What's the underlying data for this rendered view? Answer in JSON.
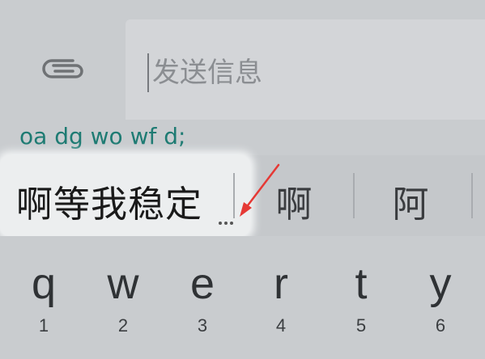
{
  "composer": {
    "attach_icon": "paperclip-icon",
    "placeholder": "发送信息"
  },
  "ime": {
    "pinyin": "oa dg wo wf d;",
    "candidates": [
      {
        "text": "啊等我稳定"
      },
      {
        "text": "啊"
      },
      {
        "text": "阿"
      }
    ],
    "more_icon": "ellipsis-icon"
  },
  "keyboard": {
    "keys": [
      {
        "letter": "q",
        "number": "1"
      },
      {
        "letter": "w",
        "number": "2"
      },
      {
        "letter": "e",
        "number": "3"
      },
      {
        "letter": "r",
        "number": "4"
      },
      {
        "letter": "t",
        "number": "5"
      },
      {
        "letter": "y",
        "number": "6"
      }
    ]
  },
  "colors": {
    "background": "#c9cccf",
    "pinyin_text": "#1e7b73",
    "annotation_arrow": "#e53935"
  }
}
